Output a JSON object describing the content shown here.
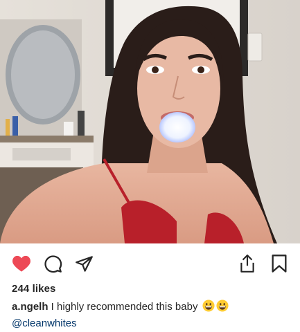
{
  "post": {
    "likes_text": "244 likes",
    "caption": {
      "username": "a.ngelh",
      "text": " I highly recommended this baby ",
      "emojis": [
        "grinning-face-emoji",
        "grinning-face-emoji"
      ],
      "mention": "@cleanwhites"
    },
    "liked": true
  },
  "icons": {
    "like": "heart-icon",
    "comment": "comment-bubble-icon",
    "share": "paper-plane-icon",
    "upload": "share-upload-icon",
    "save": "bookmark-icon"
  },
  "colors": {
    "heart_active": "#ed4956",
    "text": "#262626",
    "link": "#003569"
  }
}
